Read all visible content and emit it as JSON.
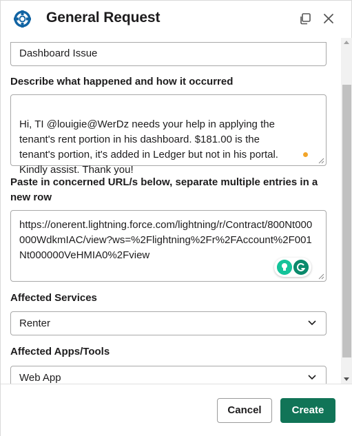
{
  "dialog": {
    "title": "General Request",
    "app_icon": "lifebuoy-icon",
    "popout_icon": "popout-window-icon",
    "close_icon": "close-icon"
  },
  "form": {
    "subject_value": "Dashboard Issue",
    "description": {
      "label": "Describe what happened and how it occurred",
      "value": "Hi, TI @louigie@WerDz needs your help in applying the\ntenant's rent portion in his dashboard. $181.00 is the\ntenant's portion, it's added in Ledger but not in his portal.\nKindly assist. Thank you!"
    },
    "urls": {
      "label": "Paste in concerned URL/s below, separate multiple entries in a new row",
      "value": "https://onerent.lightning.force.com/lightning/r/Contract/800Nt000000WdkmIAC/view?ws=%2Flightning%2Fr%2FAccount%2F001Nt000000VeHMIA0%2Fview"
    },
    "affected_services": {
      "label": "Affected Services",
      "value": "Renter"
    },
    "affected_apps": {
      "label": "Affected Apps/Tools",
      "value": "Web App"
    }
  },
  "footer": {
    "cancel_label": "Cancel",
    "create_label": "Create"
  },
  "colors": {
    "accent": "#1264a3",
    "primary_button": "#117457",
    "grammarly": "#15c39a",
    "status_dot": "#f2a52a"
  }
}
